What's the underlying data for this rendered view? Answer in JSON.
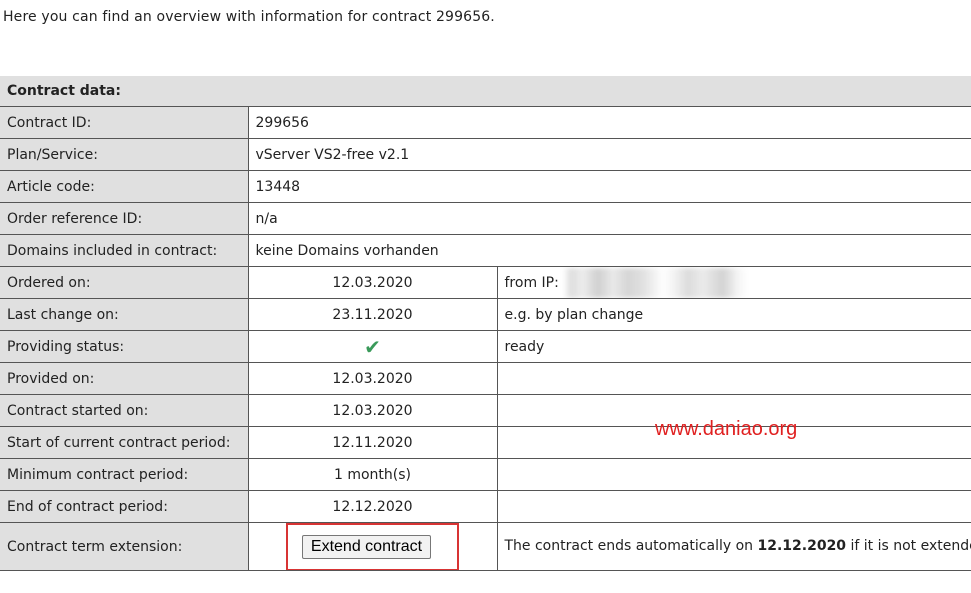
{
  "intro": "Here you can find an overview with information for contract 299656.",
  "section_title": "Contract data:",
  "rows": {
    "contract_id": {
      "label": "Contract ID:",
      "value": "299656"
    },
    "plan": {
      "label": "Plan/Service:",
      "value": "vServer VS2-free v2.1"
    },
    "article": {
      "label": "Article code:",
      "value": "13448"
    },
    "order_ref": {
      "label": "Order reference ID:",
      "value": "n/a"
    },
    "domains": {
      "label": "Domains included in contract:",
      "value": "keine Domains vorhanden"
    },
    "ordered": {
      "label": "Ordered on:",
      "value": "12.03.2020",
      "note": "from IP:"
    },
    "last_change": {
      "label": "Last change on:",
      "value": "23.11.2020",
      "note": "e.g. by plan change"
    },
    "status": {
      "label": "Providing status:",
      "icon": "checkmark-icon",
      "note": "ready"
    },
    "provided": {
      "label": "Provided on:",
      "value": "12.03.2020"
    },
    "started": {
      "label": "Contract started on:",
      "value": "12.03.2020"
    },
    "period_start": {
      "label": "Start of current contract period:",
      "value": "12.11.2020"
    },
    "min_period": {
      "label": "Minimum contract period:",
      "value": "1 month(s)"
    },
    "period_end": {
      "label": "End of contract period:",
      "value": "12.12.2020"
    },
    "extension": {
      "label": "Contract term extension:",
      "button": "Extend contract",
      "note_before": "The contract ends automatically on ",
      "note_date": "12.12.2020",
      "note_after": " if it is not extended manually."
    }
  },
  "watermark": "www.daniao.org",
  "colors": {
    "label_bg": "#e0e0e0",
    "check": "#3a9a5a",
    "highlight": "#d83434",
    "watermark": "#e02020"
  }
}
